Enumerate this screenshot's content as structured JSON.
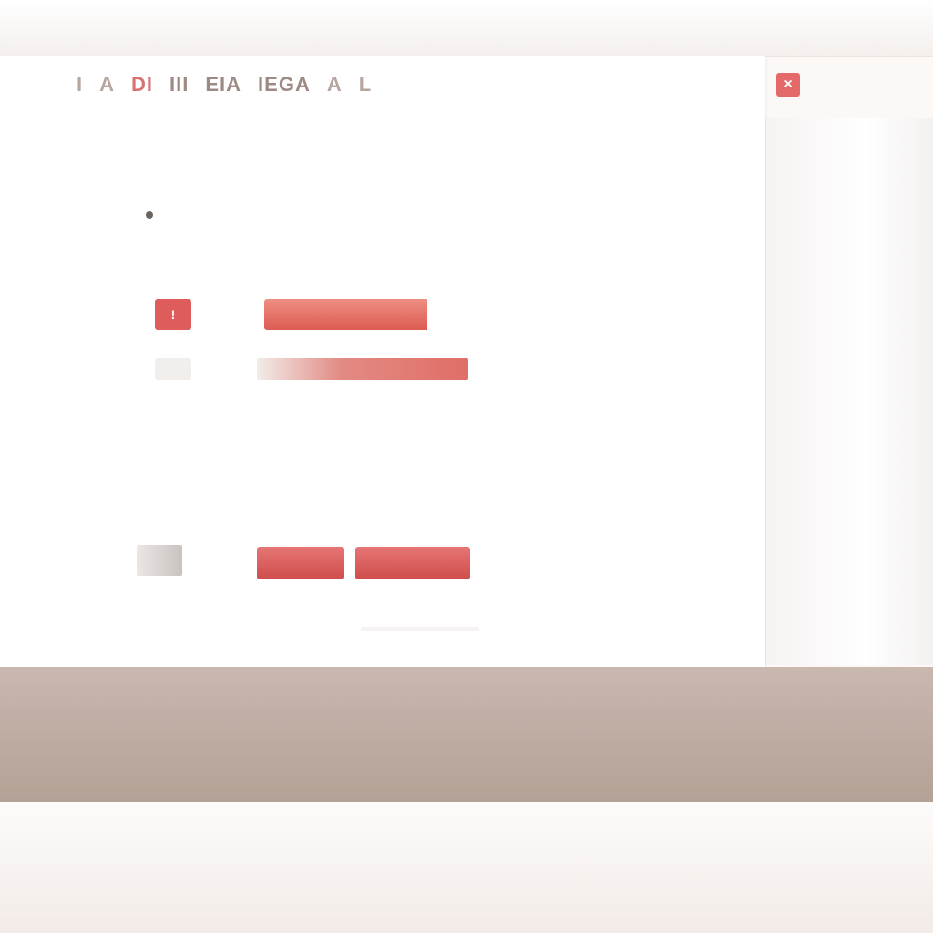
{
  "top_strip": {
    "text": ""
  },
  "header": {
    "nav": [
      {
        "label": "I",
        "accent": false
      },
      {
        "label": "A",
        "accent": false
      },
      {
        "label": "DI",
        "accent": true
      },
      {
        "label": "III",
        "accent": false
      },
      {
        "label": "EIA",
        "accent": false
      },
      {
        "label": "IEGA",
        "accent": false
      },
      {
        "label": "A",
        "accent": false
      },
      {
        "label": "L",
        "accent": false
      }
    ],
    "close_label": "×"
  },
  "content": {
    "subtitle": "",
    "title": "",
    "meta": ""
  },
  "rows": [
    {
      "badge": "!",
      "text": "",
      "fill": 0.8
    },
    {
      "badge": "",
      "text": "",
      "fill": 0.65
    }
  ],
  "paragraph": {
    "lines": [
      "",
      ""
    ]
  },
  "section": {
    "heading": "",
    "sub": ""
  },
  "lower": {
    "button_left": "",
    "button_right": "",
    "rows": [
      {
        "label": "",
        "value": ""
      },
      {
        "label": "",
        "mid": "",
        "value": ""
      }
    ]
  },
  "footer": {
    "text": ""
  },
  "colors": {
    "accent": "#df5c5c",
    "band": "#bba89e"
  }
}
